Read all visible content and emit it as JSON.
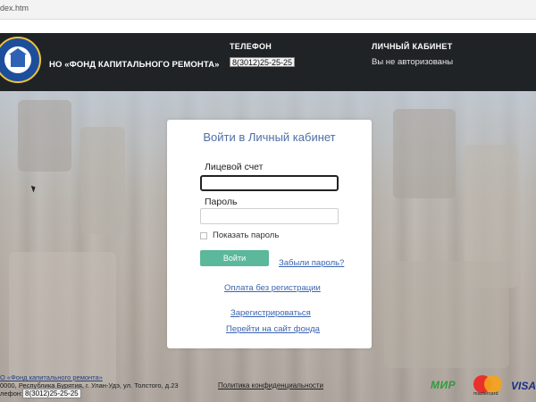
{
  "browser": {
    "url": "dex.htm"
  },
  "header": {
    "org_name": "НО «ФОНД КАПИТАЛЬНОГО РЕМОНТА»",
    "phone_title": "ТЕЛЕФОН",
    "phone_value": "8(3012)25-25-25",
    "account_title": "ЛИЧНЫЙ КАБИНЕТ",
    "account_status": "Вы не авторизованы"
  },
  "login": {
    "title": "Войти в Личный кабинет",
    "account_label": "Лицевой счет",
    "account_value": "",
    "password_label": "Пароль",
    "password_value": "",
    "show_password_label": "Показать пароль",
    "submit_label": "Войти",
    "forgot_link": "Забыли пароль?",
    "pay_without_reg_link": "Оплата без регистрации",
    "register_link": "Зарегистрироваться",
    "fund_site_link": "Перейти на сайт фонда"
  },
  "footer": {
    "org_line": "О «Фонд капитального ремонта»",
    "address_line": "0000, Республика Бурятия, г. Улан-Удэ, ул. Толстого, д.23",
    "phone_label": "лефон:",
    "phone_value": "8(3012)25-25-25",
    "privacy_link": "Политика конфиденциальности",
    "payment_logos": {
      "mir": "МИР",
      "mastercard": "mastercard",
      "visa": "VISA"
    }
  },
  "colors": {
    "header_bg": "#1f2326",
    "title_blue": "#4f6fa5",
    "button_green": "#5bb89a",
    "link_blue": "#3b64b0"
  }
}
